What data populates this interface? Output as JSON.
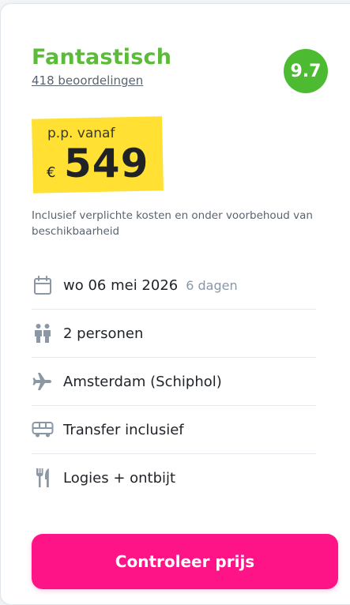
{
  "rating": {
    "label": "Fantastisch",
    "reviews": "418 beoordelingen",
    "score": "9.7",
    "color": "#5cbb3a"
  },
  "price": {
    "from_label": "p.p. vanaf",
    "currency": "€",
    "amount": "549",
    "note": "Inclusief verplichte kosten en onder voorbehoud van beschikbaarheid",
    "highlight_color": "#ffe033"
  },
  "details": [
    {
      "icon": "calendar-icon",
      "text": "wo 06 mei 2026",
      "sub": "6 dagen"
    },
    {
      "icon": "persons-icon",
      "text": "2 personen"
    },
    {
      "icon": "airplane-icon",
      "text": "Amsterdam (Schiphol)"
    },
    {
      "icon": "bus-icon",
      "text": "Transfer inclusief"
    },
    {
      "icon": "fork-knife-icon",
      "text": "Logies + ontbijt"
    }
  ],
  "cta": {
    "label": "Controleer prijs",
    "color": "#ff1487"
  }
}
